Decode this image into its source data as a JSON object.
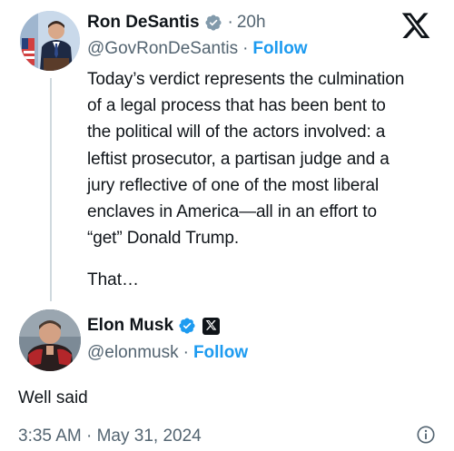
{
  "tweet": {
    "author": {
      "display_name": "Ron DeSantis",
      "handle": "@GovRonDeSantis",
      "time": "20h",
      "separator": "·",
      "follow_label": "Follow"
    },
    "text_lines": [
      "Today’s verdict represents the culmination",
      "of a legal process that has been bent to",
      "the political will of the actors involved: a",
      "leftist prosecutor, a partisan judge and a",
      "jury reflective of one of the most liberal",
      "enclaves in America—all in an effort to",
      "“get” Donald Trump."
    ],
    "truncated_text": "That…"
  },
  "reply": {
    "author": {
      "display_name": "Elon Musk",
      "handle": "@elonmusk",
      "separator": "·",
      "follow_label": "Follow"
    },
    "text": "Well said",
    "timestamp": "3:35 AM · May 31, 2024"
  },
  "icons": {
    "brand": "x-logo-icon",
    "verified": "verified-badge-icon",
    "affiliation": "x-affiliation-icon",
    "info": "info-icon"
  },
  "colors": {
    "accent": "#1d9bf0",
    "text": "#0f1419",
    "secondary": "#536471",
    "thread_line": "#cfd9de"
  }
}
